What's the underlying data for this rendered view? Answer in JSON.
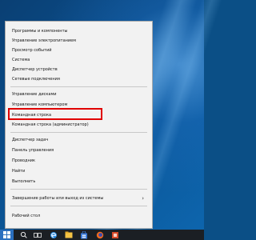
{
  "menu": {
    "items": [
      {
        "label": "Программы и компоненты"
      },
      {
        "label": "Управление электропитанием"
      },
      {
        "label": "Просмотр событий"
      },
      {
        "label": "Система"
      },
      {
        "label": "Диспетчер устройств"
      },
      {
        "label": "Сетевые подключения"
      },
      {
        "label": "Управление дисками"
      },
      {
        "label": "Управление компьютером"
      },
      {
        "label": "Командная строка"
      },
      {
        "label": "Командная строка (администратор)"
      },
      {
        "label": "Диспетчер задач"
      },
      {
        "label": "Панель управления"
      },
      {
        "label": "Проводник"
      },
      {
        "label": "Найти"
      },
      {
        "label": "Выполнить"
      },
      {
        "label": "Завершение работы или выход из системы",
        "submenu_arrow": "›"
      },
      {
        "label": "Рабочий стол"
      }
    ],
    "highlighted_item": "Управление компьютером",
    "highlight_color": "#e00000"
  },
  "taskbar": {
    "icons": [
      "windows-logo-icon",
      "search-icon",
      "task-view-icon",
      "edge-icon",
      "file-explorer-icon",
      "store-icon",
      "firefox-icon",
      "app-icon"
    ]
  },
  "colors": {
    "menu_background": "#f2f2f2",
    "taskbar": "#1b1f24",
    "start_button": "#2a6fbf",
    "desktop": "#0b5190"
  }
}
